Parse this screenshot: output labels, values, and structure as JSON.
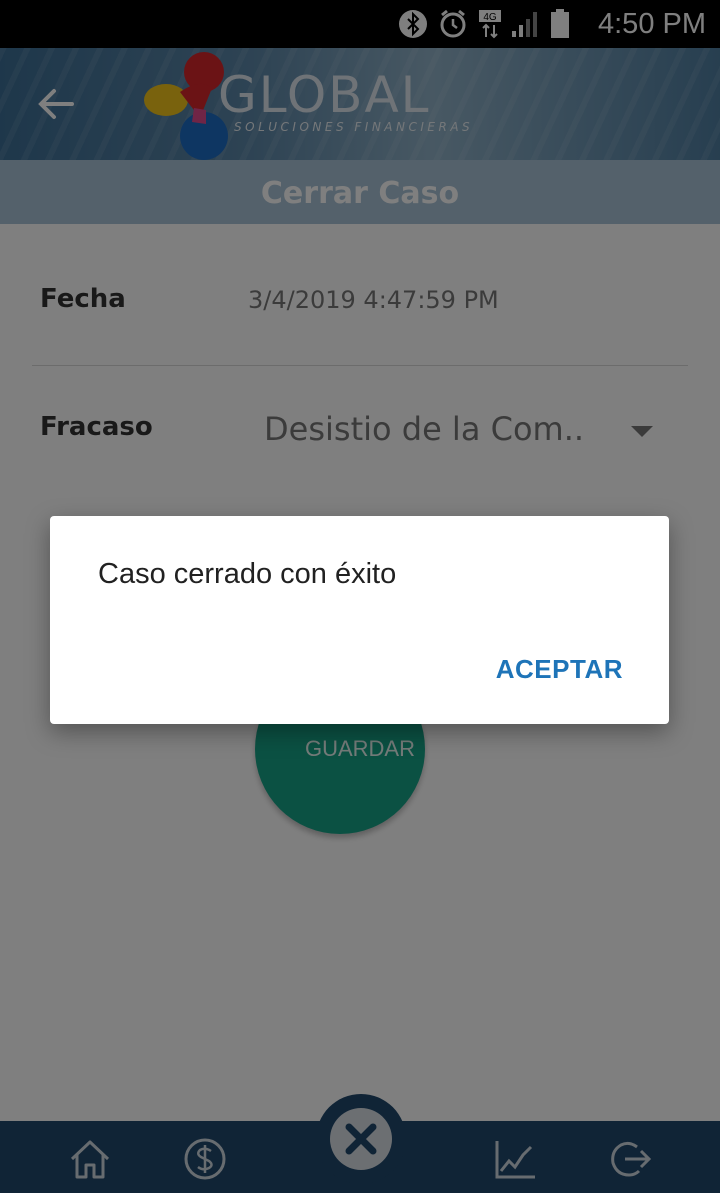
{
  "status_bar": {
    "time": "4:50 PM",
    "network": "4G",
    "icons": [
      "bluetooth-icon",
      "alarm-icon",
      "signal-icon",
      "battery-icon"
    ]
  },
  "header": {
    "logo_text": "GLOBAL",
    "logo_subtitle": "SOLUCIONES FINANCIERAS",
    "back_icon": "arrow-left-icon"
  },
  "page": {
    "title": "Cerrar Caso"
  },
  "form": {
    "date_label": "Fecha",
    "date_value": "3/4/2019 4:47:59 PM",
    "failure_label": "Fracaso",
    "failure_value": "Desistio de la Com..",
    "save_label": "GUARDAR"
  },
  "dialog": {
    "message": "Caso cerrado con éxito",
    "accept_label": "ACEPTAR"
  },
  "bottom_nav": {
    "items": [
      "home-icon",
      "dollar-icon",
      "close-icon",
      "chart-icon",
      "logout-icon"
    ]
  },
  "colors": {
    "accent_blue": "#1e74b8",
    "nav_bg": "#20486c",
    "save_green": "#16a287"
  }
}
